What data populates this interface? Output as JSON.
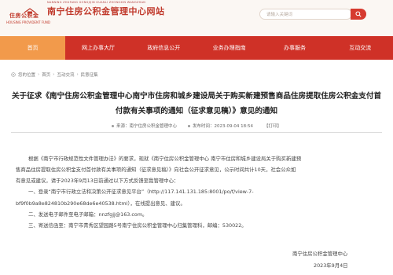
{
  "header": {
    "logo_text": "住房公积金",
    "logo_sub": "HOUSING PROVIDENT FUND",
    "site_title": "南宁住房公积金管理中心网站",
    "site_subtitle": "NANNING ZHUFANG GONGJIJIN GUANLI ZHONGXIN WANGZHAN",
    "search_placeholder": "请输入关键词",
    "brand_color": "#cf3127"
  },
  "nav": {
    "items": [
      {
        "label": "首页",
        "active": true
      },
      {
        "label": "网上办事大厅",
        "active": false
      },
      {
        "label": "政府信息公开",
        "active": false
      },
      {
        "label": "业务办理指南",
        "active": false
      },
      {
        "label": "办事服务",
        "active": false
      },
      {
        "label": "互动交流",
        "active": false
      }
    ]
  },
  "breadcrumb": {
    "items": [
      "您的位置",
      "首页",
      "互动交流",
      "民意征集"
    ]
  },
  "article": {
    "title_line1": "关于征求《南宁住房公积金管理中心南宁市住房和城乡建设局关于购买新建预售商品住房提取住房公积金支付首",
    "title_line2": "付款有关事项的通知（征求意见稿）》意见的通知",
    "source": "来源：南宁住房公积金管理中心",
    "published": "发布时间：2023-09-04 18:54",
    "print": "【打印】",
    "paragraphs": [
      "根据《南宁市行政规范性文件管理办法》的要求，现就《南宁住房公积金管理中心 南宁市住房和城乡建设局关于购买新建预",
      "售商品住房提取住房公积金支付首付款有关事项的通知（征求意见稿）》向社会公开征求意见，公示时间共计10天，社会公众如",
      "有意见或建议，请于2023年9月13日前通过以下方式反馈至我管理中心：",
      "一、登录“南宁市行政立法和决策公开征求意见平台”（http://117.141.131.185:8001/po/f/view-7-",
      "bf9f0b9a8e824810b290e68de6e40538.html），在线提出意见、建议。",
      "二、发送电子邮件至电子邮箱：nnzfgjj@163.com。",
      "三、寄送信函至：南宁市青秀区望园路5号南宁住房公积金管理中心归集管理科，邮编：530022。"
    ],
    "signature_org": "南宁住房公积金管理中心",
    "signature_date": "2023年9月4日"
  }
}
